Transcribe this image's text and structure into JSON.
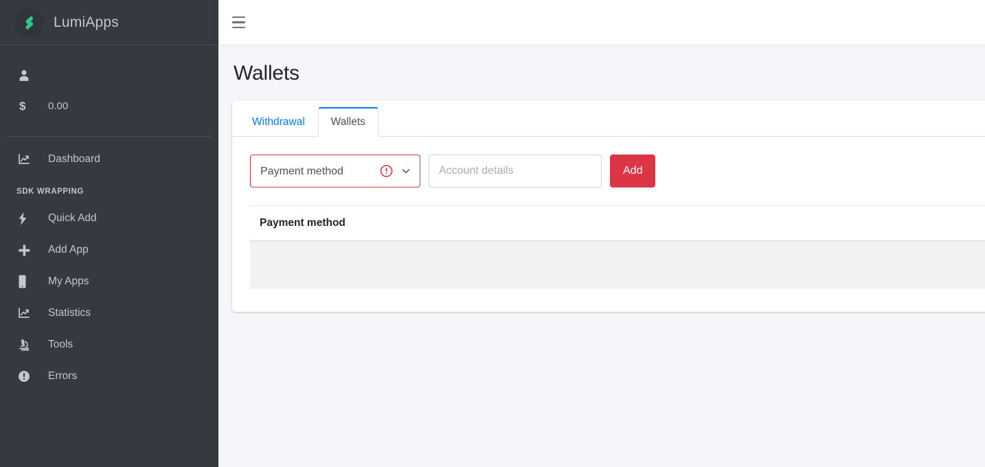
{
  "brand": {
    "title": "LumiApps",
    "logo_icon": "lumiapps-logo-icon",
    "logo_color": "#2fc48d"
  },
  "sidebar": {
    "user": {
      "icon": "user-icon",
      "balance_icon": "dollar-icon",
      "balance": "0.00"
    },
    "items": [
      {
        "icon": "chart-line-icon",
        "label": "Dashboard"
      }
    ],
    "section_header": "SDK WRAPPING",
    "sdk_items": [
      {
        "icon": "bolt-icon",
        "label": "Quick Add"
      },
      {
        "icon": "plus-icon",
        "label": "Add App"
      },
      {
        "icon": "mobile-icon",
        "label": "My Apps"
      },
      {
        "icon": "chart-line-icon",
        "label": "Statistics"
      },
      {
        "icon": "microscope-icon",
        "label": "Tools"
      },
      {
        "icon": "exclamation-circle-icon",
        "label": "Errors"
      }
    ]
  },
  "topbar": {
    "menu_icon": "hamburger-menu-icon"
  },
  "page": {
    "title": "Wallets"
  },
  "tabs": [
    {
      "label": "Withdrawal",
      "active": false
    },
    {
      "label": "Wallets",
      "active": true
    }
  ],
  "form": {
    "payment_method": {
      "selected": "Payment method",
      "options": [
        "Payment method"
      ],
      "error_icon": "exclamation-circle-icon",
      "chevron_icon": "chevron-down-icon",
      "invalid": true,
      "border_color": "#dc3545"
    },
    "account_details": {
      "placeholder": "Account details",
      "value": ""
    },
    "add_button": {
      "label": "Add",
      "color": "#dc3545"
    }
  },
  "table": {
    "columns": [
      "Payment method"
    ],
    "rows": [
      {
        "payment_method": ""
      }
    ]
  },
  "colors": {
    "sidebar_bg": "#343a40",
    "content_bg": "#f4f6f9",
    "accent_blue": "#007bff",
    "danger_red": "#dc3545",
    "row_grey": "#f2f2f2"
  }
}
